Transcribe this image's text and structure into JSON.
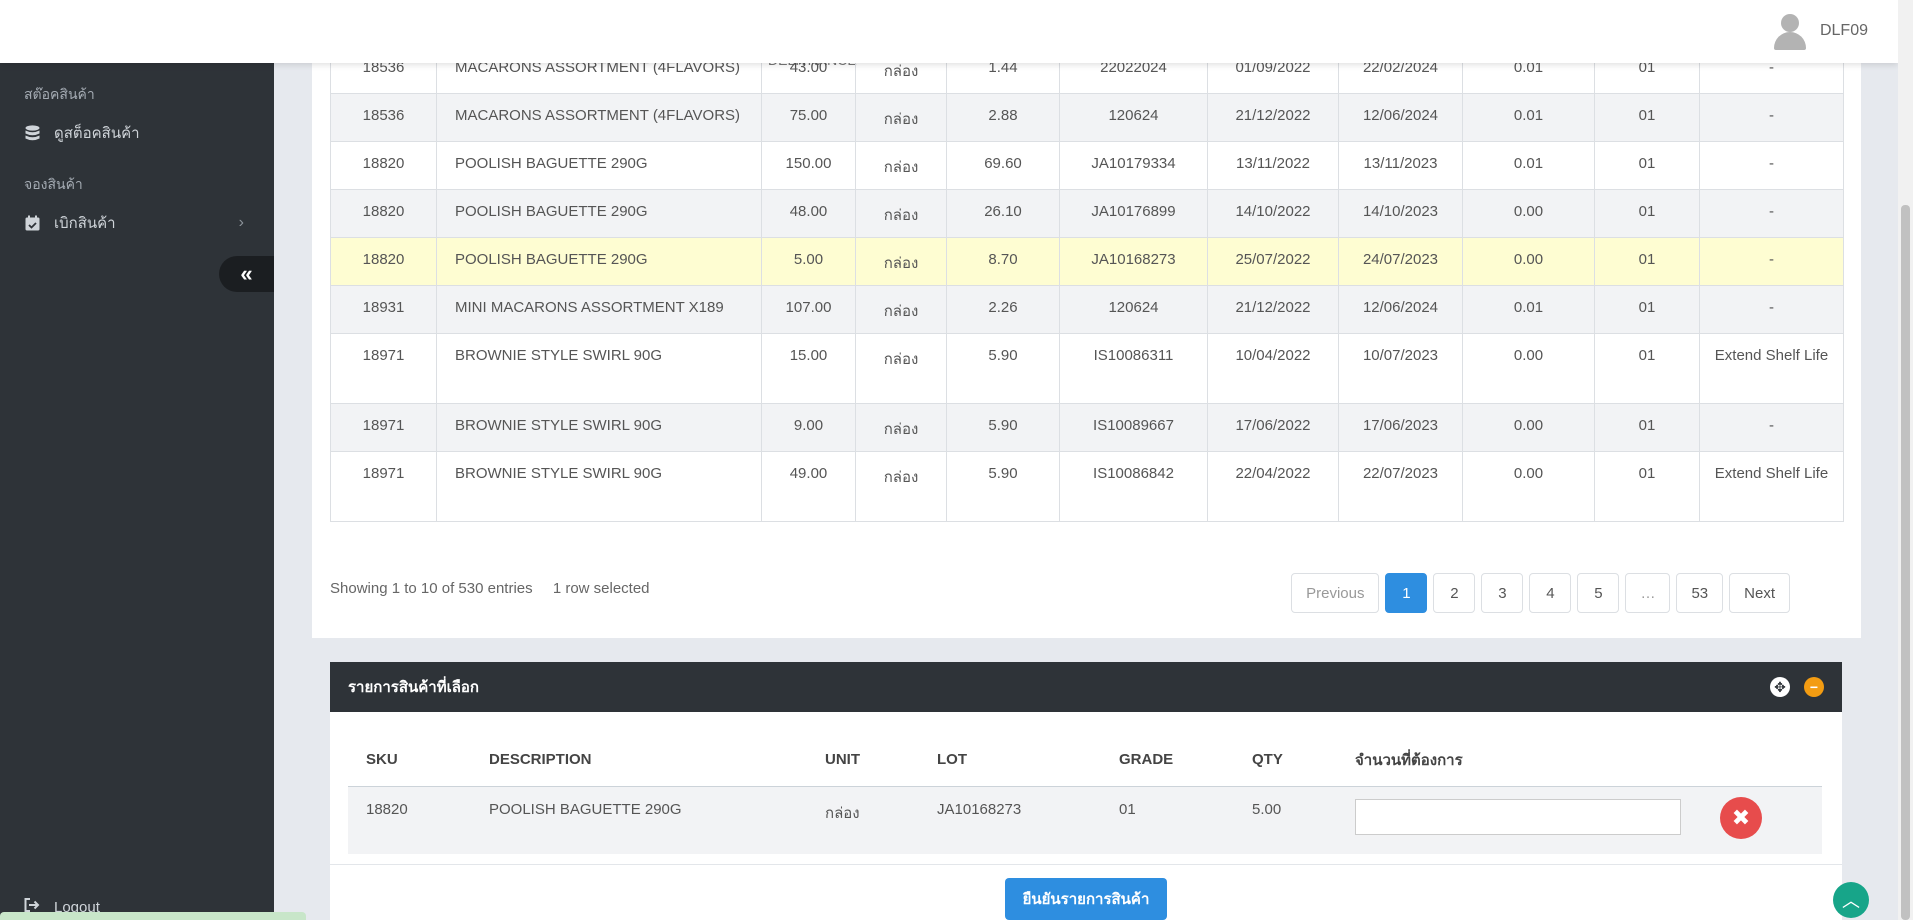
{
  "header": {
    "username": "DLF09"
  },
  "sidebar": {
    "section_stock": "สต๊อคสินค้า",
    "item_view_stock": "ดูสต็อคสินค้า",
    "section_reserve": "จองสินค้า",
    "item_withdraw": "เบิกสินค้า",
    "collapse_glyph": "«",
    "logout": "Logout"
  },
  "table": {
    "cutoff_text": "DELITRANCE",
    "rows": [
      [
        "18536",
        "MACARONS ASSORTMENT (4FLAVORS)",
        "43.00",
        "กล่อง",
        "1.44",
        "22022024",
        "01/09/2022",
        "22/02/2024",
        "0.01",
        "01",
        "-"
      ],
      [
        "18536",
        "MACARONS ASSORTMENT (4FLAVORS)",
        "75.00",
        "กล่อง",
        "2.88",
        "120624",
        "21/12/2022",
        "12/06/2024",
        "0.01",
        "01",
        "-"
      ],
      [
        "18820",
        "POOLISH BAGUETTE 290G",
        "150.00",
        "กล่อง",
        "69.60",
        "JA10179334",
        "13/11/2022",
        "13/11/2023",
        "0.01",
        "01",
        "-"
      ],
      [
        "18820",
        "POOLISH BAGUETTE 290G",
        "48.00",
        "กล่อง",
        "26.10",
        "JA10176899",
        "14/10/2022",
        "14/10/2023",
        "0.00",
        "01",
        "-"
      ],
      [
        "18820",
        "POOLISH BAGUETTE 290G",
        "5.00",
        "กล่อง",
        "8.70",
        "JA10168273",
        "25/07/2022",
        "24/07/2023",
        "0.00",
        "01",
        "-"
      ],
      [
        "18931",
        "MINI MACARONS ASSORTMENT X189",
        "107.00",
        "กล่อง",
        "2.26",
        "120624",
        "21/12/2022",
        "12/06/2024",
        "0.01",
        "01",
        "-"
      ],
      [
        "18971",
        "BROWNIE STYLE SWIRL 90G",
        "15.00",
        "กล่อง",
        "5.90",
        "IS10086311",
        "10/04/2022",
        "10/07/2023",
        "0.00",
        "01",
        "Extend Shelf Life"
      ],
      [
        "18971",
        "BROWNIE STYLE SWIRL 90G",
        "9.00",
        "กล่อง",
        "5.90",
        "IS10089667",
        "17/06/2022",
        "17/06/2023",
        "0.00",
        "01",
        "-"
      ],
      [
        "18971",
        "BROWNIE STYLE SWIRL 90G",
        "49.00",
        "กล่อง",
        "5.90",
        "IS10086842",
        "22/04/2022",
        "22/07/2023",
        "0.00",
        "01",
        "Extend Shelf Life"
      ]
    ],
    "selected_row_index": 4
  },
  "info": {
    "showing": "Showing 1 to 10 of 530 entries",
    "selected": "1 row selected"
  },
  "pagination": [
    "Previous",
    "1",
    "2",
    "3",
    "4",
    "5",
    "…",
    "53",
    "Next"
  ],
  "selected_panel": {
    "title": "รายการสินค้าที่เลือก",
    "columns": [
      "SKU",
      "DESCRIPTION",
      "UNIT",
      "LOT",
      "GRADE",
      "QTY",
      "จำนวนที่ต้องการ"
    ],
    "row": [
      "18820",
      "POOLISH BAGUETTE 290G",
      "กล่อง",
      "JA10168273",
      "01",
      "5.00"
    ],
    "qty_placeholder": "",
    "confirm_label": "ยืนยันรายการสินค้า"
  },
  "colors": {
    "sidebar": "#2e3338",
    "accent": "#2e8ee0",
    "selected_row": "#fefdd2",
    "danger": "#e74c4c",
    "warning": "#f39c12"
  }
}
